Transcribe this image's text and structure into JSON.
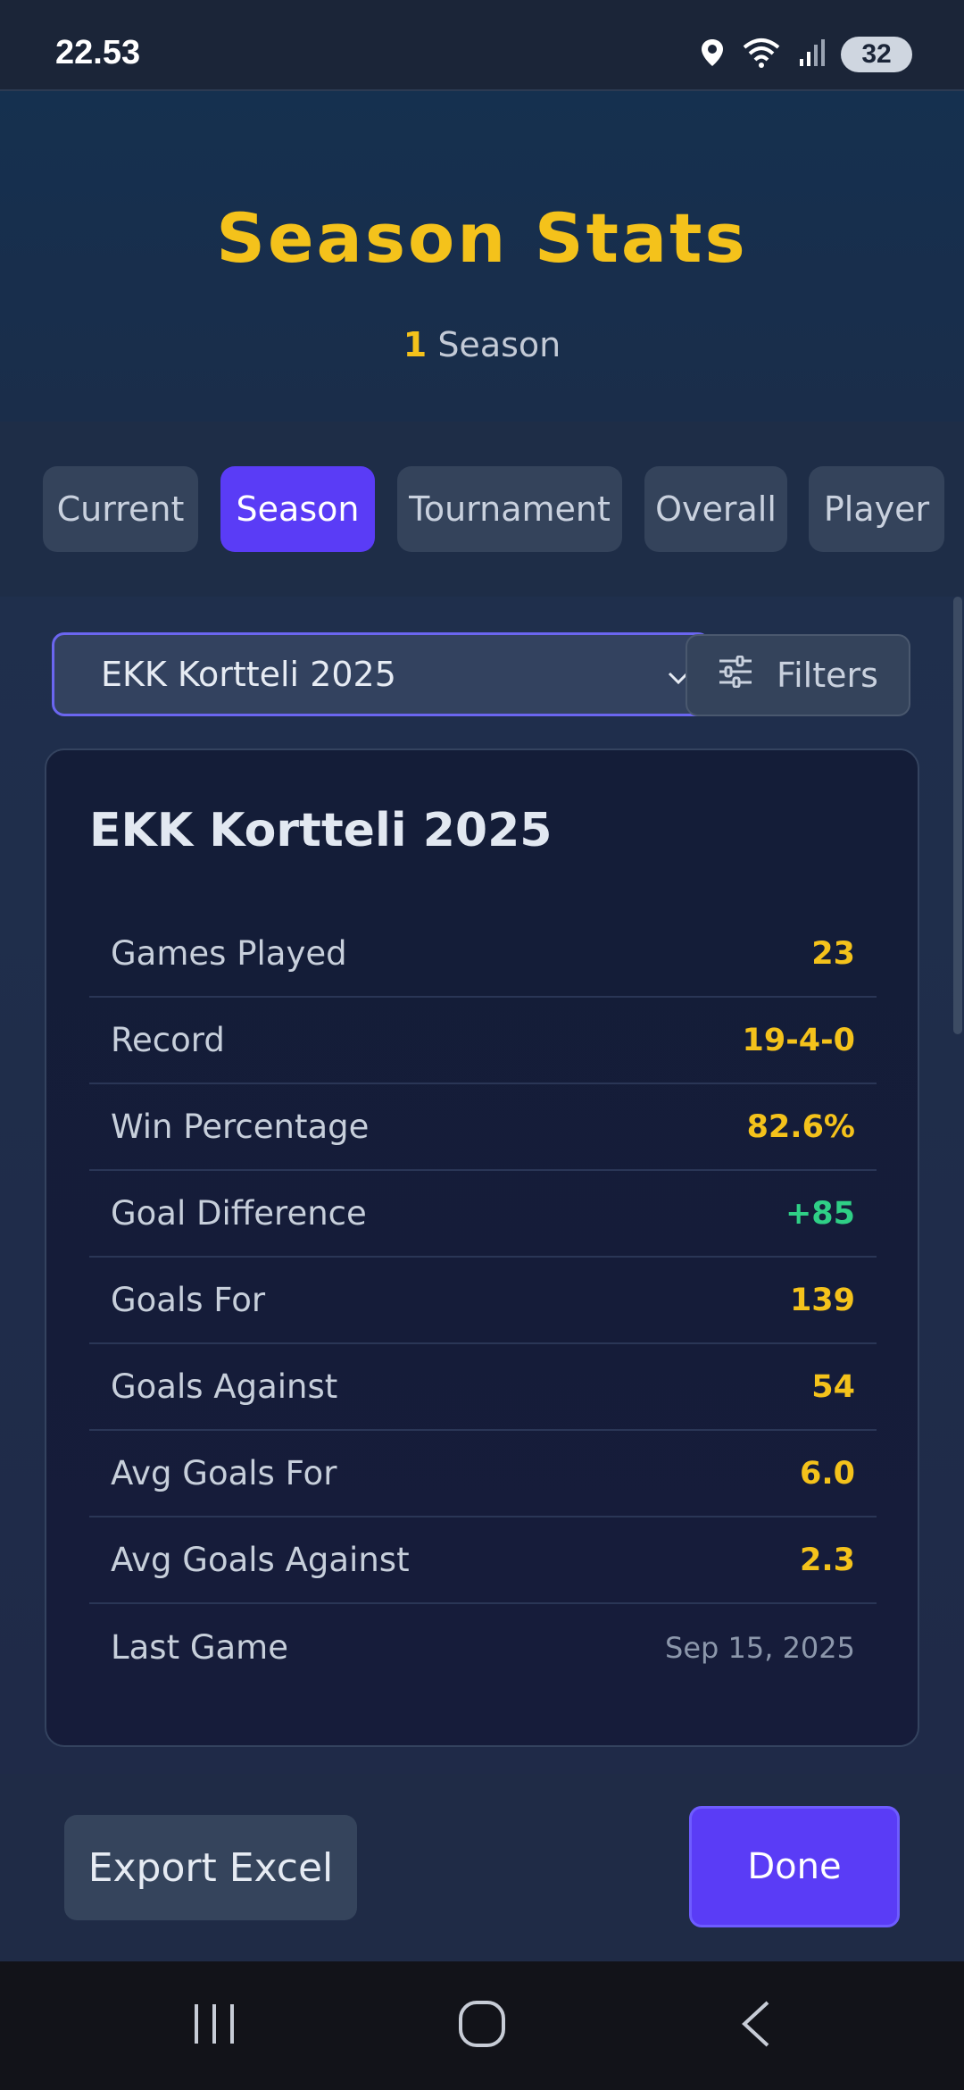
{
  "status_bar": {
    "time": "22.53",
    "battery": "32"
  },
  "header": {
    "title": "Season Stats",
    "count": "1",
    "count_label": "Season"
  },
  "tabs": [
    {
      "label": "Current",
      "active": false
    },
    {
      "label": "Season",
      "active": true
    },
    {
      "label": "Tournament",
      "active": false
    },
    {
      "label": "Overall",
      "active": false
    },
    {
      "label": "Player",
      "active": false
    }
  ],
  "selector": {
    "selected": "EKK Kortteli 2025",
    "filters_label": "Filters"
  },
  "card": {
    "title": "EKK Kortteli 2025",
    "rows": [
      {
        "label": "Games Played",
        "value": "23"
      },
      {
        "label": "Record",
        "value": "19-4-0"
      },
      {
        "label": "Win Percentage",
        "value": "82.6%"
      },
      {
        "label": "Goal Difference",
        "value": "+85"
      },
      {
        "label": "Goals For",
        "value": "139"
      },
      {
        "label": "Goals Against",
        "value": "54"
      },
      {
        "label": "Avg Goals For",
        "value": "6.0"
      },
      {
        "label": "Avg Goals Against",
        "value": "2.3"
      },
      {
        "label": "Last Game",
        "value": "Sep 15, 2025"
      }
    ]
  },
  "footer": {
    "export_label": "Export Excel",
    "done_label": "Done"
  },
  "colors": {
    "accent": "#5a3cf6",
    "highlight": "#f4c21b",
    "positive": "#2fcf86"
  },
  "icons": [
    "location-icon",
    "wifi-icon",
    "signal-icon",
    "battery-icon",
    "chevron-down-icon",
    "sliders-icon",
    "recent-apps-icon",
    "home-icon",
    "back-icon"
  ]
}
